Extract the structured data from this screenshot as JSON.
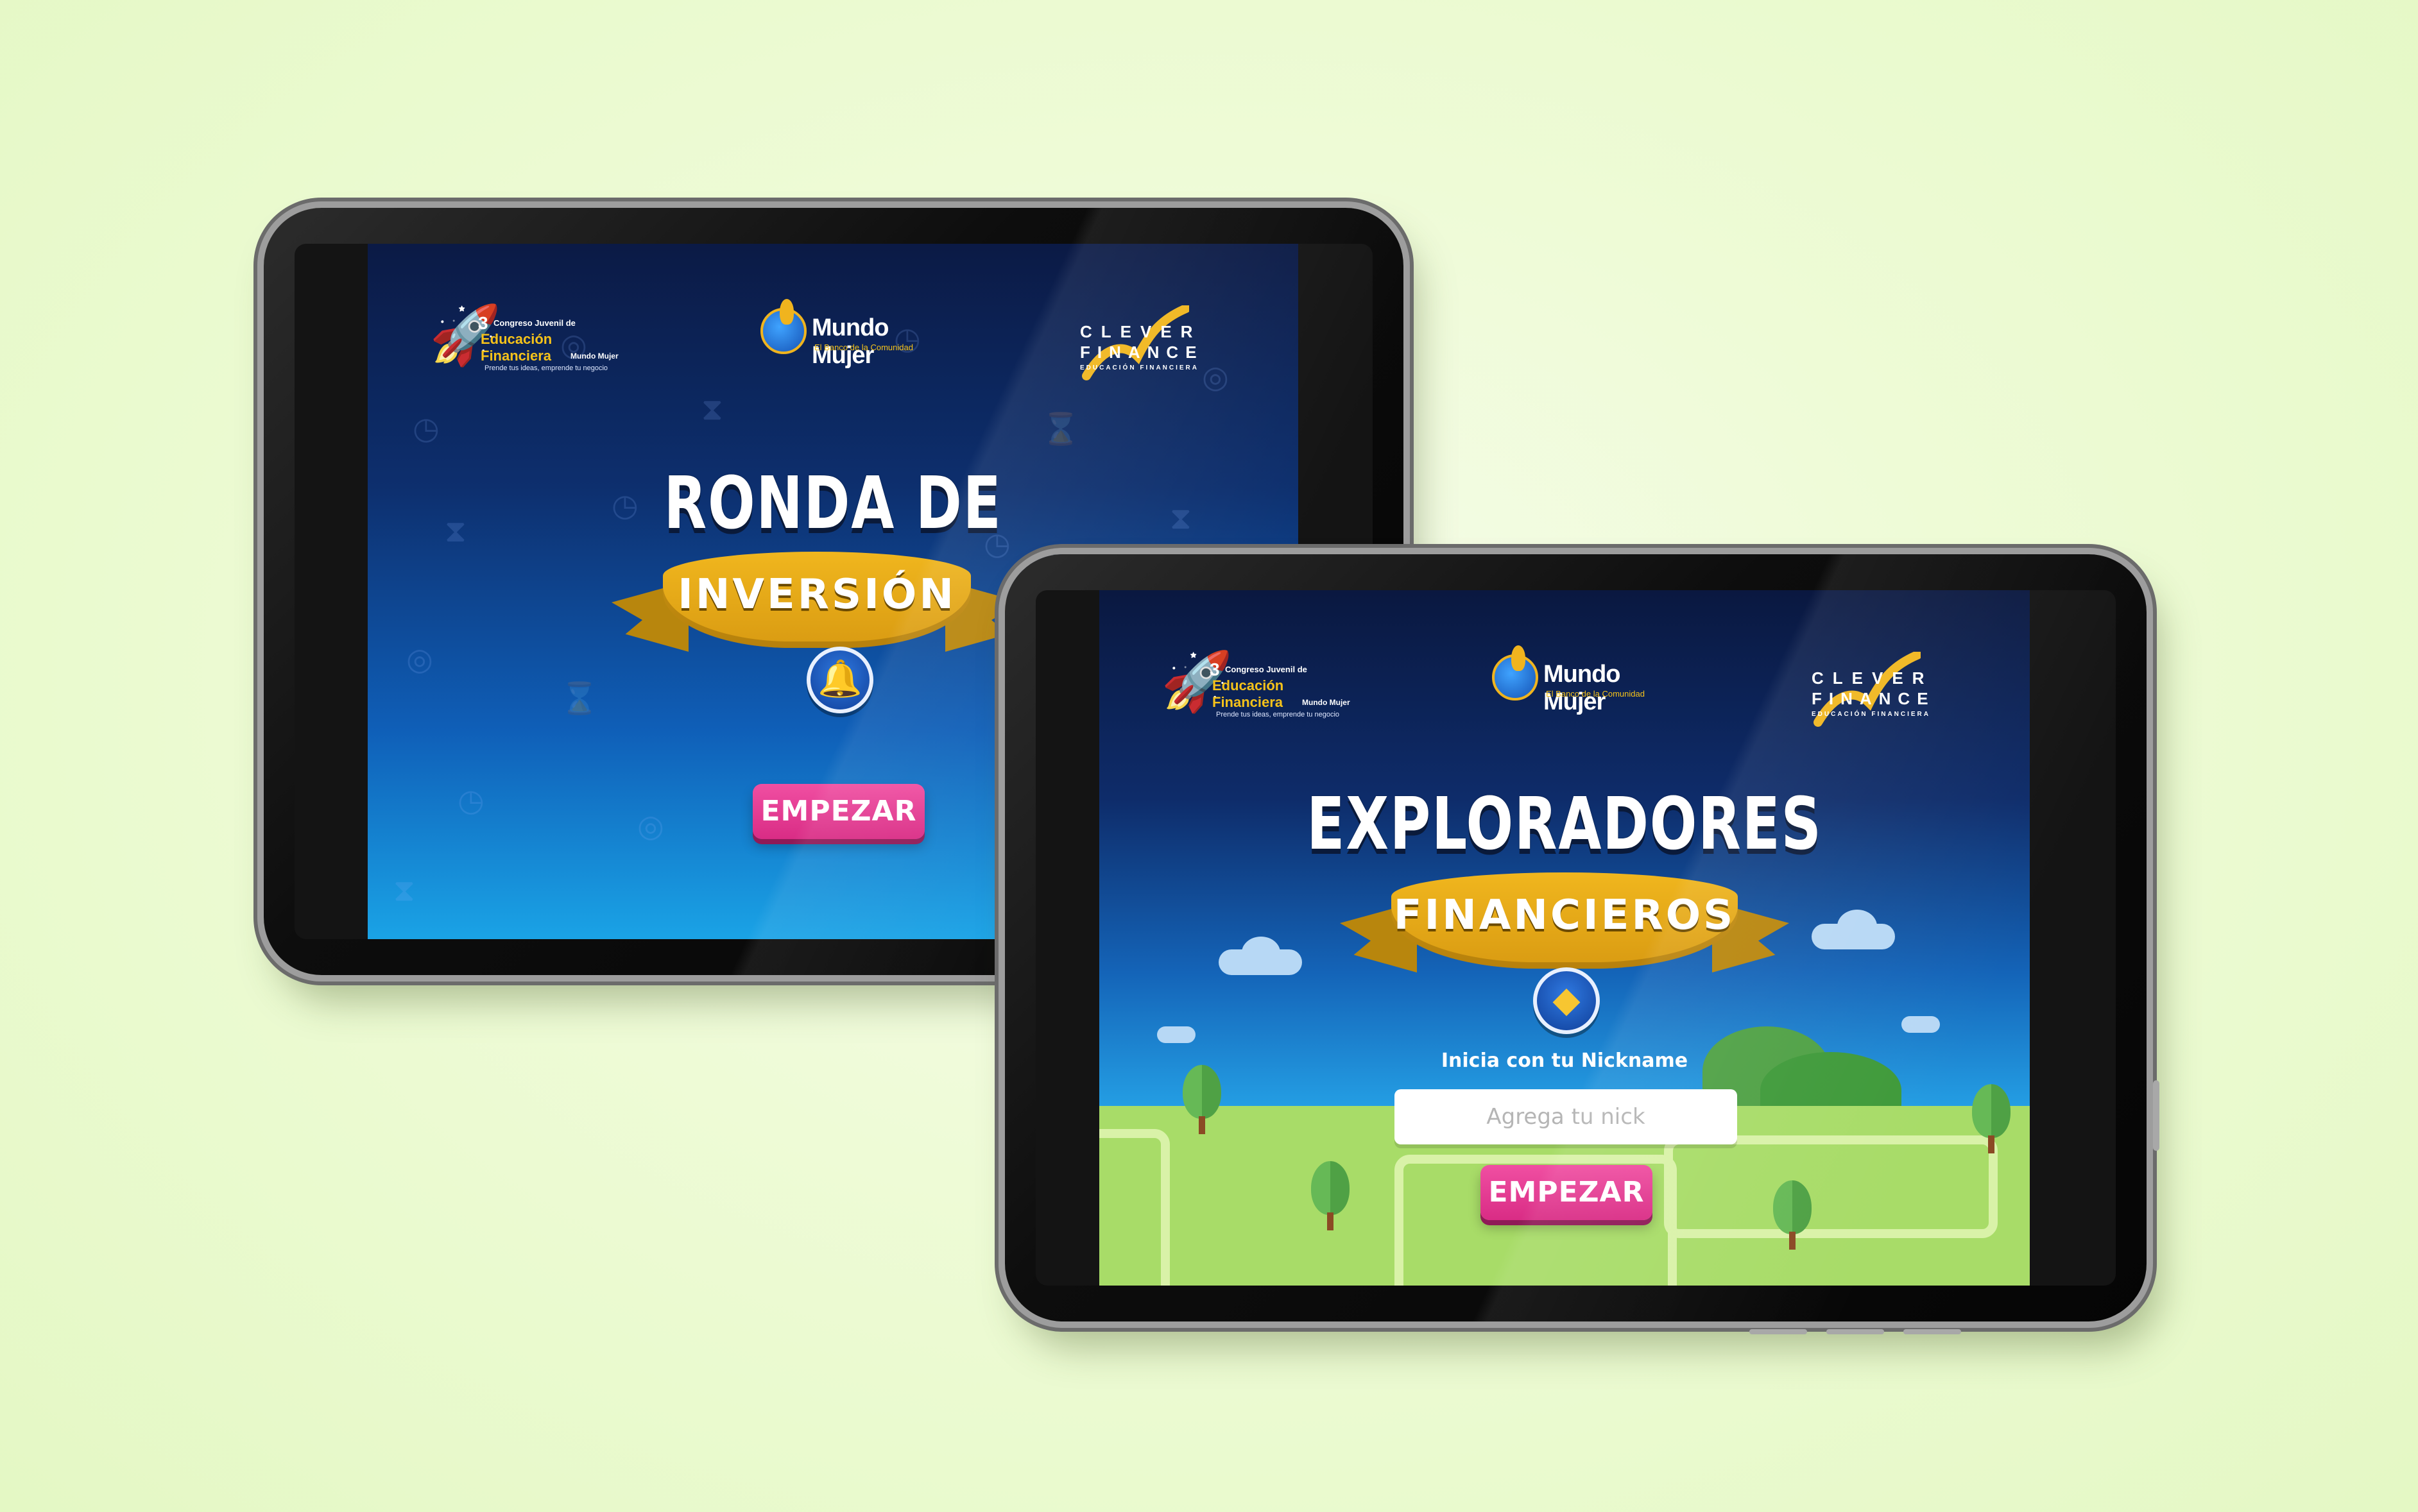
{
  "logos": {
    "congreso": {
      "number": "3",
      "ordinal": "er",
      "line1": "Congreso Juvenil de",
      "line2": "Educación Financiera",
      "line3": "Mundo Mujer",
      "tagline": "Prende tus ideas, emprende tu negocio"
    },
    "mundo_mujer": {
      "name": "Mundo Mujer",
      "subtitle": "El Banco de la Comunidad"
    },
    "clever": {
      "line1": "CLEVER",
      "line2": "FINANCE",
      "line3": "EDUCACIÓN FINANCIERA"
    }
  },
  "screen1": {
    "title": "RONDA DE",
    "ribbon": "INVERSIÓN",
    "medal_icon": "bell-icon",
    "start_button": "EMPEZAR"
  },
  "screen2": {
    "title": "EXPLORADORES",
    "ribbon": "FINANCIEROS",
    "medal_icon": "colombia-map-icon",
    "nickname_label": "Inicia con tu Nickname",
    "nickname_placeholder": "Agrega tu nick",
    "start_button": "EMPEZAR"
  },
  "colors": {
    "background": "#eefbd6",
    "screen_navy": "#0b1a45",
    "screen_blue": "#1aa3e6",
    "ribbon_gold": "#f0b61e",
    "button_pink": "#e23a92",
    "grass": "#a8dc68"
  }
}
